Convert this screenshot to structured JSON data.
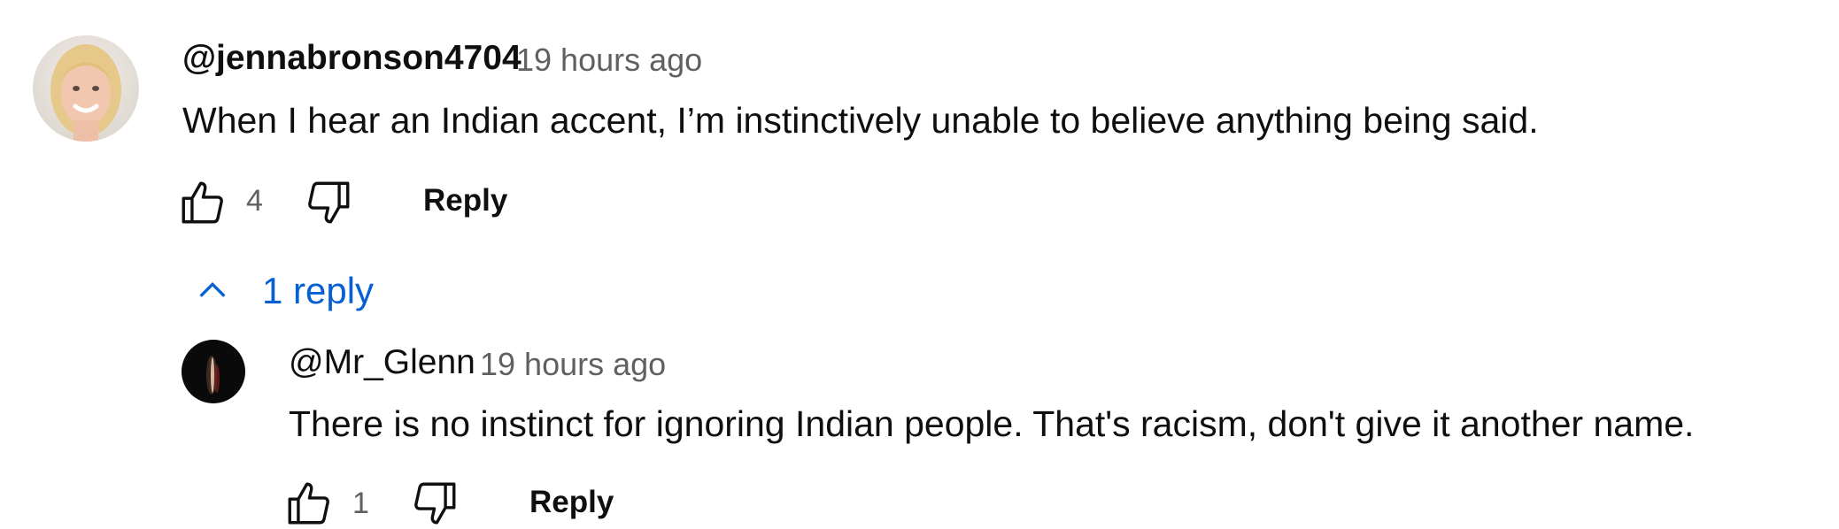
{
  "comment": {
    "author": "@jennabronson4704",
    "time": "19 hours ago",
    "text": "When I hear an Indian accent, I’m instinctively unable to believe anything being said.",
    "like_count": "4",
    "reply_label": "Reply",
    "avatar_icon": "avatar-woman-photo"
  },
  "replies_toggle": {
    "label": "1 reply",
    "icon": "chevron-up-icon"
  },
  "reply": {
    "author": "@Mr_Glenn",
    "time": "19 hours ago",
    "text": "There is no instinct for ignoring Indian people. That's racism, don't give it another name.",
    "like_count": "1",
    "reply_label": "Reply",
    "avatar_icon": "avatar-dark-photo"
  },
  "colors": {
    "link_blue": "#065fd4",
    "meta_gray": "#606060",
    "text": "#0f0f0f"
  }
}
